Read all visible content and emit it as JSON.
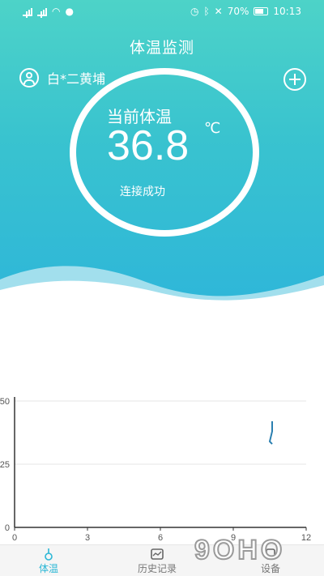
{
  "status_bar": {
    "battery_pct": "70%",
    "time": "10:13"
  },
  "header": {
    "title": "体温监测",
    "user_name": "白*二黄埔"
  },
  "reading": {
    "label": "当前体温",
    "value": "36.8",
    "unit": "℃",
    "connection_status": "连接成功"
  },
  "chart_data": {
    "type": "line",
    "x_ticks": [
      "0",
      "3",
      "6",
      "9",
      "12"
    ],
    "y_ticks": [
      "0",
      "25",
      "50"
    ],
    "xlim": [
      0,
      12
    ],
    "ylim": [
      0,
      50
    ],
    "series": [
      {
        "x": [
          10.6,
          10.6,
          10.5,
          10.6
        ],
        "y": [
          42,
          38,
          34,
          33
        ]
      }
    ]
  },
  "tabs": [
    {
      "label": "体温",
      "icon": "thermometer-icon",
      "active": true
    },
    {
      "label": "历史记录",
      "icon": "history-icon",
      "active": false
    },
    {
      "label": "设备",
      "icon": "device-icon",
      "active": false
    }
  ],
  "colors": {
    "accent": "#2bb7d6",
    "header_top": "#4dd3c8",
    "header_bottom": "#2eb6d9"
  },
  "watermark": "9OHO"
}
